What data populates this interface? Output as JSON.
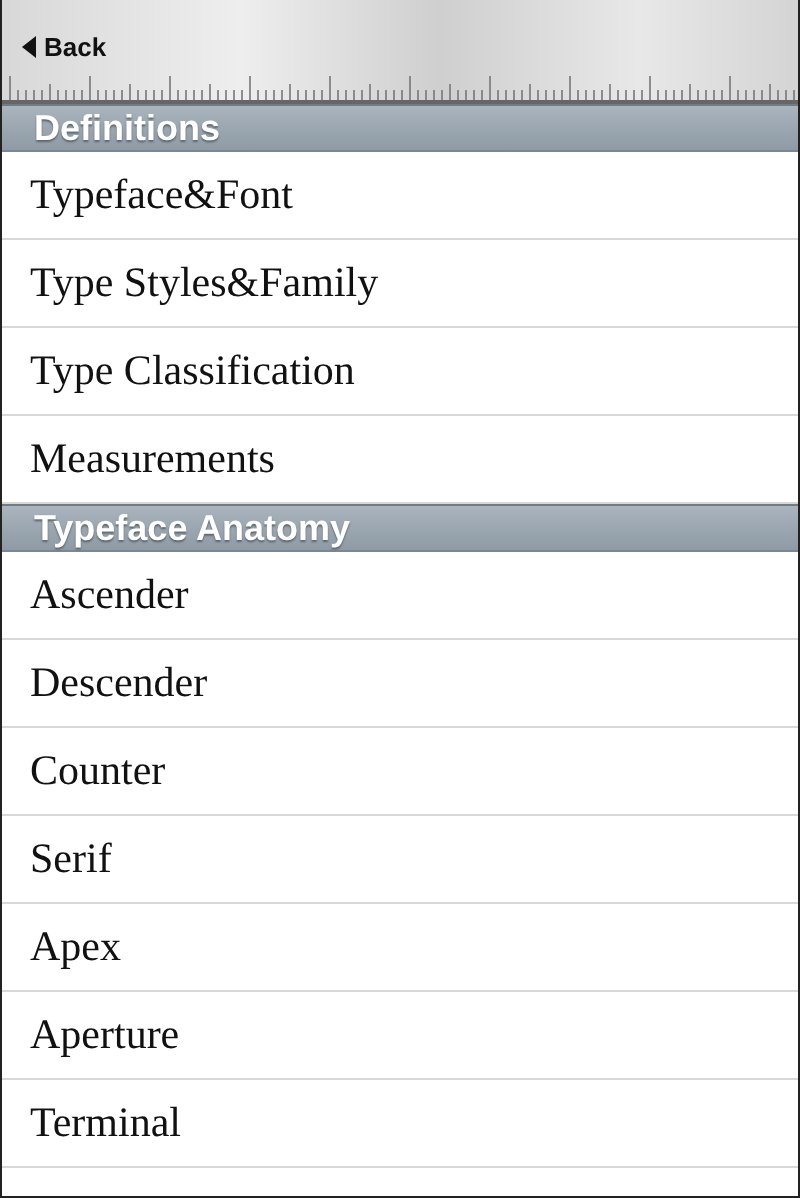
{
  "nav_bar": {
    "back_button": "Back"
  },
  "sections": [
    {
      "title": "Definitions",
      "items": [
        "Typeface&Font",
        "Type Styles&Family",
        "Type Classification",
        "Measurements"
      ]
    },
    {
      "title": "Typeface Anatomy",
      "items": [
        "Ascender",
        "Descender",
        "Counter",
        "Serif",
        "Apex",
        "Aperture",
        "Terminal"
      ]
    }
  ]
}
